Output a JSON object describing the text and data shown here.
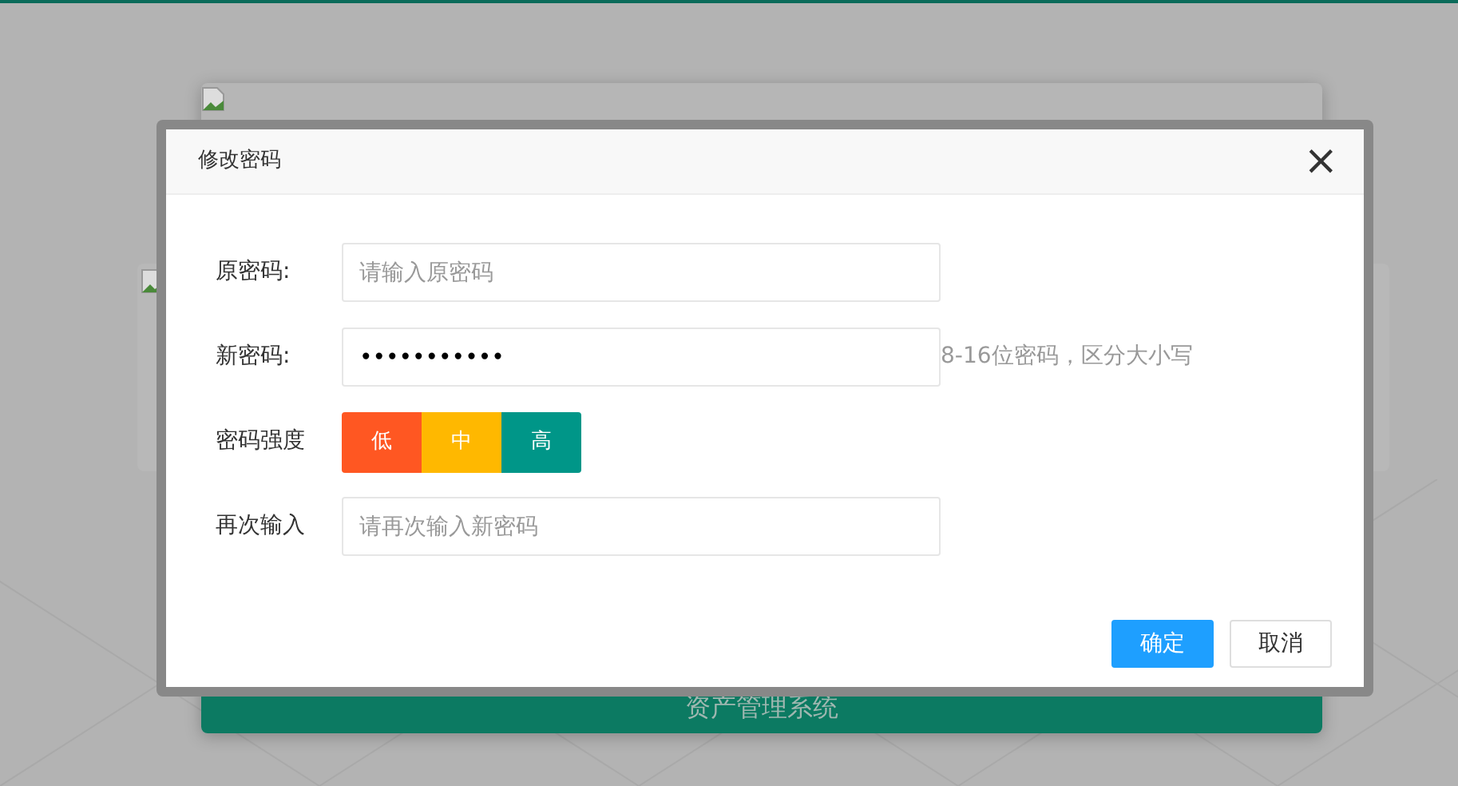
{
  "background": {
    "button_label": "资产管理系统"
  },
  "dialog": {
    "title": "修改密码",
    "close": "×",
    "fields": [
      {
        "kind": "input",
        "label": "原密码:",
        "placeholder": "请输入原密码"
      },
      {
        "kind": "input",
        "label": "新密码:",
        "value": "•••••••••••",
        "hint": "8-16位密码，区分大小写"
      },
      {
        "kind": "strength",
        "label": "密码强度",
        "levels": [
          {
            "label": "低",
            "color": "#ff5722"
          },
          {
            "label": "中",
            "color": "#ffb800"
          },
          {
            "label": "高",
            "color": "#009688"
          }
        ]
      },
      {
        "kind": "input",
        "label": "再次输入",
        "placeholder": "请再次输入新密码"
      }
    ],
    "buttons": [
      {
        "label": "确定",
        "kind": "primary"
      },
      {
        "label": "取消",
        "kind": "default"
      }
    ]
  }
}
